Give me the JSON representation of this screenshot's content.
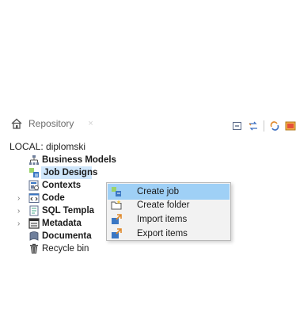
{
  "repository_tab": {
    "title": "Repository",
    "close": "×"
  },
  "project_label": "LOCAL: diplomski",
  "tree": [
    {
      "label": "Business Models",
      "bold": true,
      "arrow": "",
      "icon": "business-models-icon"
    },
    {
      "label": "Job Designs",
      "bold": true,
      "arrow": "",
      "icon": "job-designs-icon",
      "selected": true
    },
    {
      "label": "Contexts",
      "bold": true,
      "arrow": "",
      "icon": "contexts-icon"
    },
    {
      "label": "Code",
      "bold": true,
      "arrow": "›",
      "icon": "code-icon"
    },
    {
      "label": "SQL Templa",
      "bold": true,
      "arrow": "›",
      "icon": "sql-templates-icon"
    },
    {
      "label": "Metadata",
      "bold": true,
      "arrow": "›",
      "icon": "metadata-icon"
    },
    {
      "label": "Documenta",
      "bold": true,
      "arrow": "",
      "icon": "documentation-icon"
    },
    {
      "label": "Recycle bin",
      "bold": true,
      "arrow": "",
      "icon": "recycle-bin-icon"
    }
  ],
  "context_menu": [
    {
      "label": "Create job",
      "icon": "create-job-icon",
      "highlighted": true
    },
    {
      "label": "Create folder",
      "icon": "create-folder-icon"
    },
    {
      "label": "Import items",
      "icon": "import-items-icon"
    },
    {
      "label": "Export items",
      "icon": "export-items-icon"
    }
  ],
  "toolbar_icons": [
    "collapse-all-icon",
    "link-editor-icon",
    "refresh-icon",
    "view-menu-icon"
  ]
}
